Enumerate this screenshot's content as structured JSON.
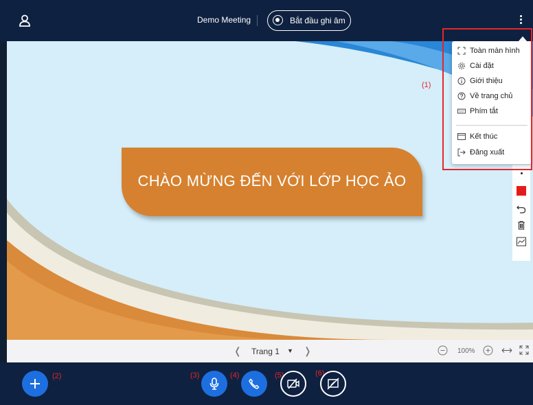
{
  "topbar": {
    "meeting_title": "Demo Meeting",
    "record_label": "Bắt đầu ghi âm",
    "user_icon": "user-icon",
    "more_icon": "kebab-menu-icon"
  },
  "menu": {
    "items": [
      {
        "label": "Toàn màn hình",
        "icon": "fullscreen-icon"
      },
      {
        "label": "Cài đặt",
        "icon": "gear-icon"
      },
      {
        "label": "Giới thiệu",
        "icon": "info-icon"
      },
      {
        "label": "Về trang chủ",
        "icon": "help-icon"
      },
      {
        "label": "Phím tắt",
        "icon": "keyboard-icon"
      },
      {
        "label": "Kết thúc",
        "icon": "window-icon"
      },
      {
        "label": "Đăng xuất",
        "icon": "logout-icon"
      }
    ]
  },
  "slide": {
    "banner_text": "CHÀO MỪNG ĐẾN VỚI LỚP HỌC ẢO"
  },
  "annotations": [
    "(1)",
    "(2)",
    "(3)",
    "(4)",
    "(5)",
    "(6)"
  ],
  "pager": {
    "page_label": "Trang 1",
    "zoom": "100%"
  },
  "colors": {
    "bar": "#0f2140",
    "accent": "#1d6fe0",
    "banner": "#d6812f",
    "annotation": "#e4262a",
    "pen_color": "#e51b1b"
  }
}
